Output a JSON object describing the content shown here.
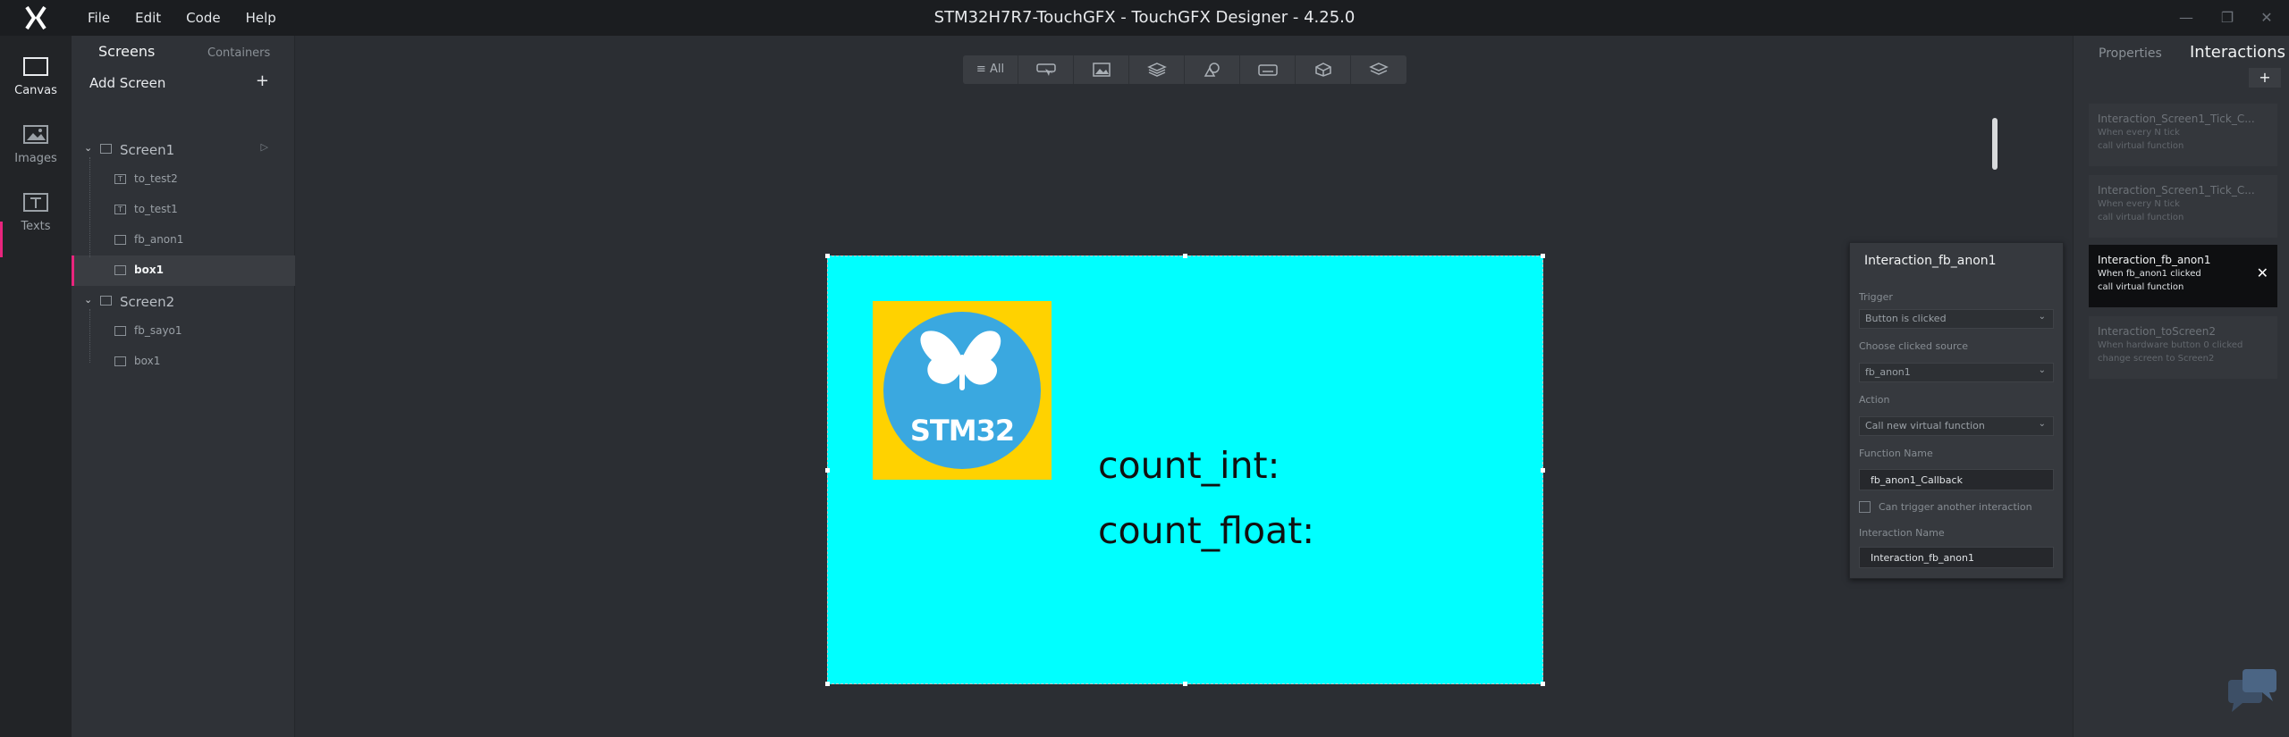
{
  "app": {
    "window_title": "STM32H7R7-TouchGFX - TouchGFX Designer - 4.25.0",
    "menu": [
      "File",
      "Edit",
      "Code",
      "Help"
    ],
    "window_controls": [
      "minimize-icon",
      "maximize-icon",
      "close-icon"
    ]
  },
  "leftbar": {
    "items": [
      {
        "label": "Canvas",
        "icon": "canvas-icon",
        "active": true
      },
      {
        "label": "Images",
        "icon": "images-icon",
        "active": false
      },
      {
        "label": "Texts",
        "icon": "texts-icon",
        "active": false
      }
    ]
  },
  "screens_panel": {
    "tab_active": "Screens",
    "tab_inactive": "Containers",
    "add_screen": "Add Screen",
    "tree": [
      {
        "label": "Screen1",
        "type": "screen"
      },
      {
        "label": "to_test2",
        "type": "text"
      },
      {
        "label": "to_test1",
        "type": "text"
      },
      {
        "label": "fb_anon1",
        "type": "flexbutton"
      },
      {
        "label": "box1",
        "type": "box",
        "selected": true
      },
      {
        "label": "Screen2",
        "type": "screen"
      },
      {
        "label": "fb_sayo1",
        "type": "flexbutton"
      },
      {
        "label": "box1",
        "type": "box"
      }
    ]
  },
  "toolbar": {
    "all_label": "All",
    "buttons": [
      "all-icon",
      "button-icon",
      "image-icon",
      "container-icon",
      "shapes-icon",
      "keyboard-icon",
      "3d-icon",
      "layers-icon"
    ]
  },
  "canvas": {
    "background": "#00ffff",
    "logo_text": "STM32",
    "count_int_label": "count_int:",
    "count_float_label": "count_float:"
  },
  "interaction_editor": {
    "title": "Interaction_fb_anon1",
    "trigger_label": "Trigger",
    "trigger_value": "Button is clicked",
    "source_label": "Choose clicked source",
    "source_value": "fb_anon1",
    "action_label": "Action",
    "action_value": "Call new virtual function",
    "function_name_label": "Function Name",
    "function_name_value": "fb_anon1_Callback",
    "can_trigger_label": "Can trigger another interaction",
    "interaction_name_label": "Interaction Name",
    "interaction_name_value": "Interaction_fb_anon1"
  },
  "interactions_panel": {
    "tab_inactive": "Properties",
    "tab_active": "Interactions",
    "add_label": "+",
    "cards": [
      {
        "title": "Interaction_Screen1_Tick_C...",
        "line1": "When every N tick",
        "line2": "call virtual function",
        "active": false
      },
      {
        "title": "Interaction_Screen1_Tick_C...",
        "line1": "When every N tick",
        "line2": "call virtual function",
        "active": false
      },
      {
        "title": "Interaction_fb_anon1",
        "line1": "When fb_anon1 clicked",
        "line2": "call virtual function",
        "active": true
      },
      {
        "title": "Interaction_toScreen2",
        "line1": "When hardware button 0 clicked",
        "line2": "change screen to Screen2",
        "active": false
      }
    ]
  }
}
